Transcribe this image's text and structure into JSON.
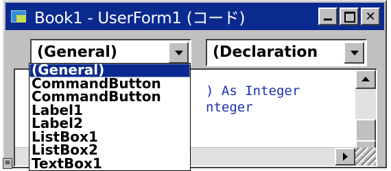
{
  "window": {
    "title": "Book1 - UserForm1 (コード)",
    "title_color": "#0a2a8f",
    "icon": "excel-vbe-icon"
  },
  "caption_buttons": {
    "minimize": "minimize-icon",
    "maximize": "maximize-icon",
    "close_label": "✕"
  },
  "object_combo": {
    "value": "(General)"
  },
  "procedure_combo": {
    "value": "(Declaration"
  },
  "code": {
    "lines": [
      ") As Integer",
      "nteger"
    ],
    "text_color": "#1a2fb0"
  },
  "dropdown": {
    "items": [
      "(General)",
      "CommandButton",
      "CommandButton",
      "Label1",
      "Label2",
      "ListBox1",
      "ListBox2",
      "TextBox1"
    ],
    "selected_index": 0
  },
  "split_button_label": "≡"
}
